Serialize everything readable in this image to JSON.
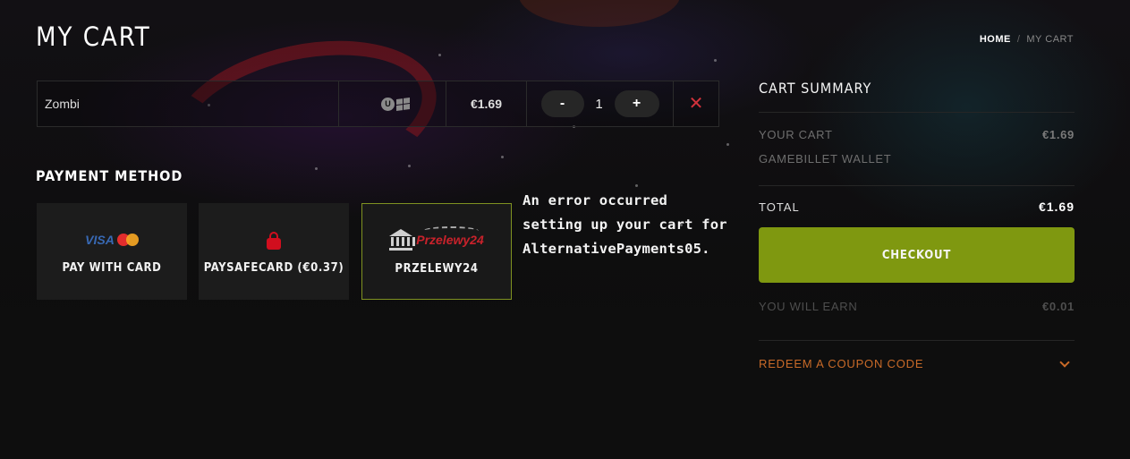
{
  "page": {
    "title": "MY CART"
  },
  "breadcrumb": {
    "home": "HOME",
    "separator": "/",
    "current": "MY CART"
  },
  "cart_items": [
    {
      "name": "Zombi",
      "platform_icons": [
        "uplay-icon",
        "windows-icon"
      ],
      "price": "€1.69",
      "quantity": "1",
      "decrement_label": "-",
      "increment_label": "+",
      "remove_label": "✕"
    }
  ],
  "payment": {
    "title": "PAYMENT METHOD",
    "methods": [
      {
        "label": "PAY WITH CARD",
        "logo": "visa-mastercard",
        "visa_text": "VISA",
        "selected": false
      },
      {
        "label": "PAYSAFECARD (€0.37)",
        "logo": "paysafecard-lock",
        "selected": false
      },
      {
        "label": "PRZELEWY24",
        "logo": "przelewy24",
        "logo_text": "Przelewy",
        "logo_number": "24",
        "selected": true
      }
    ],
    "error": "An error occurred setting up your cart for AlternativePayments05."
  },
  "summary": {
    "title": "CART SUMMARY",
    "your_cart_label": "YOUR CART",
    "your_cart_amount": "€1.69",
    "wallet_label": "GAMEBILLET WALLET",
    "total_label": "TOTAL",
    "total_amount": "€1.69",
    "checkout_label": "CHECKOUT",
    "earn_label": "YOU WILL EARN",
    "earn_amount": "€0.01",
    "coupon_label": "REDEEM A COUPON CODE"
  },
  "colors": {
    "accent_green": "#7f9810",
    "coupon_orange": "#c96a28",
    "remove_red": "#d2323c",
    "selected_border": "#7f9221"
  }
}
